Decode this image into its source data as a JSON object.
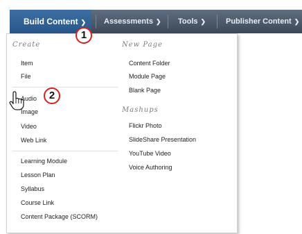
{
  "nav": {
    "tabs": [
      {
        "label": "Build Content"
      },
      {
        "label": "Assessments"
      },
      {
        "label": "Tools"
      },
      {
        "label": "Publisher Content"
      }
    ]
  },
  "menu": {
    "create": {
      "header": "Create",
      "items": [
        "Item",
        "File",
        "Audio",
        "Image",
        "Video",
        "Web Link",
        "Learning Module",
        "Lesson Plan",
        "Syllabus",
        "Course Link",
        "Content Package (SCORM)"
      ]
    },
    "new_page": {
      "header": "New Page",
      "items": [
        "Content Folder",
        "Module Page",
        "Blank Page"
      ]
    },
    "mashups": {
      "header": "Mashups",
      "items": [
        "Flickr Photo",
        "SlideShare Presentation",
        "YouTube Video",
        "Voice Authoring"
      ]
    }
  },
  "callouts": [
    "1",
    "2"
  ],
  "icons": {
    "dropdown": "chevron-down-icon",
    "cursor": "hand-pointer-icon"
  }
}
